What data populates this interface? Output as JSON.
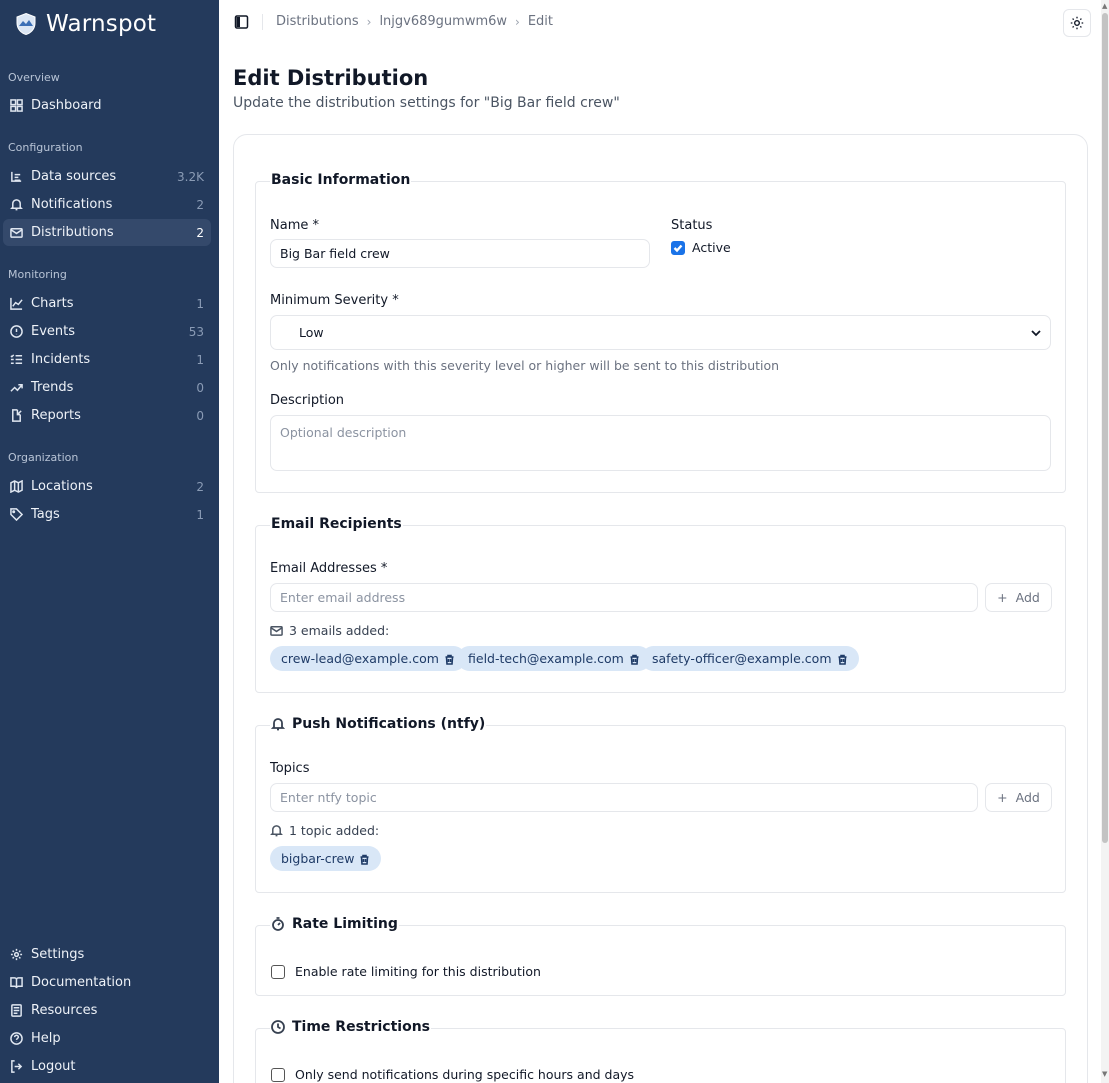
{
  "app": {
    "name": "Warnspot"
  },
  "sidebar": {
    "sections": [
      {
        "title": "Overview"
      },
      {
        "title": "Configuration"
      },
      {
        "title": "Monitoring"
      },
      {
        "title": "Organization"
      }
    ],
    "items": [
      {
        "label": "Dashboard",
        "count": "",
        "icon": "dashboard-icon"
      },
      {
        "label": "Data sources",
        "count": "3.2K",
        "icon": "list-icon"
      },
      {
        "label": "Notifications",
        "count": "2",
        "icon": "bell-icon"
      },
      {
        "label": "Distributions",
        "count": "2",
        "icon": "mail-icon",
        "active": true
      },
      {
        "label": "Charts",
        "count": "1",
        "icon": "line-chart-icon"
      },
      {
        "label": "Events",
        "count": "53",
        "icon": "shield-icon"
      },
      {
        "label": "Incidents",
        "count": "1",
        "icon": "list-checks-icon"
      },
      {
        "label": "Trends",
        "count": "0",
        "icon": "trending-up-icon"
      },
      {
        "label": "Reports",
        "count": "0",
        "icon": "file-edit-icon"
      },
      {
        "label": "Locations",
        "count": "2",
        "icon": "map-icon"
      },
      {
        "label": "Tags",
        "count": "1",
        "icon": "tag-icon"
      }
    ],
    "footer": [
      {
        "label": "Settings",
        "icon": "gear-icon"
      },
      {
        "label": "Documentation",
        "icon": "book-icon"
      },
      {
        "label": "Resources",
        "icon": "newspaper-icon"
      },
      {
        "label": "Help",
        "icon": "help-icon"
      },
      {
        "label": "Logout",
        "icon": "logout-icon"
      }
    ]
  },
  "breadcrumb": {
    "items": [
      "Distributions",
      "lnjgv689gumwm6w",
      "Edit"
    ]
  },
  "page": {
    "title": "Edit Distribution",
    "subtitle": "Update the distribution settings for \"Big Bar field crew\""
  },
  "basic": {
    "legend": "Basic Information",
    "name_label": "Name *",
    "name_value": "Big Bar field crew",
    "status_label": "Status",
    "active_label": "Active",
    "active_checked": true,
    "severity_label": "Minimum Severity *",
    "severity_value": "Low",
    "severity_help": "Only notifications with this severity level or higher will be sent to this distribution",
    "description_label": "Description",
    "description_placeholder": "Optional description"
  },
  "email": {
    "legend": "Email Recipients",
    "label": "Email Addresses *",
    "placeholder": "Enter email address",
    "add_label": "Add",
    "added_text": "3 emails added:",
    "chips": [
      "crew-lead@example.com",
      "field-tech@example.com",
      "safety-officer@example.com"
    ]
  },
  "push": {
    "legend": "Push Notifications (ntfy)",
    "label": "Topics",
    "placeholder": "Enter ntfy topic",
    "add_label": "Add",
    "added_text": "1 topic added:",
    "chips": [
      "bigbar-crew"
    ]
  },
  "rate": {
    "legend": "Rate Limiting",
    "checkbox_label": "Enable rate limiting for this distribution"
  },
  "time": {
    "legend": "Time Restrictions",
    "checkbox_label": "Only send notifications during specific hours and days"
  },
  "colors": {
    "sidebar": "#243a5c",
    "accent": "#1a73e8",
    "chip": "#d9e7f7"
  }
}
